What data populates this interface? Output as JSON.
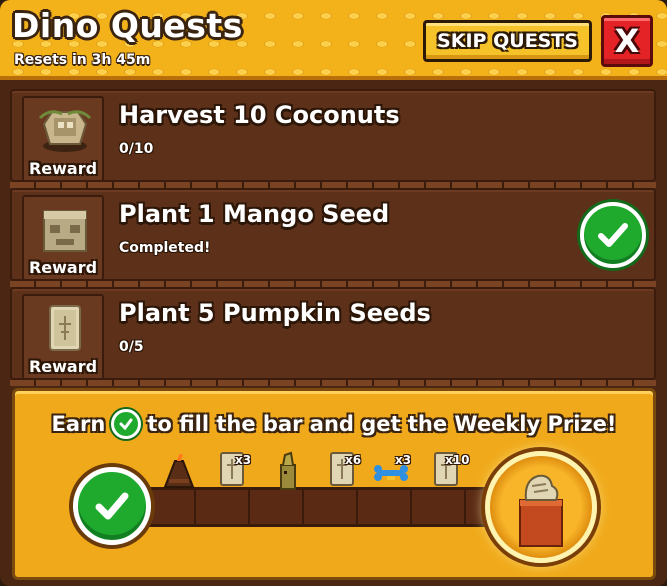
{
  "header": {
    "title": "Dino Quests",
    "resets_text": "Resets in 3h 45m",
    "skip_label": "SKIP QUESTS",
    "close_label": "X"
  },
  "quests": [
    {
      "title": "Harvest 10 Coconuts",
      "progress": "0/10",
      "reward_label": "Reward",
      "reward_icon": "coconut-icon",
      "completed": false
    },
    {
      "title": "Plant 1 Mango Seed",
      "progress": "Completed!",
      "reward_label": "Reward",
      "reward_icon": "stone-block-icon",
      "completed": true
    },
    {
      "title": "Plant 5 Pumpkin Seeds",
      "progress": "0/5",
      "reward_label": "Reward",
      "reward_icon": "stone-tablet-icon",
      "completed": false
    }
  ],
  "weekly": {
    "earn_before": "Earn",
    "earn_after": "to fill the bar and get the Weekly Prize!",
    "progress_fraction": 0.0,
    "milestones": [
      {
        "icon": "volcano-icon",
        "multiplier": ""
      },
      {
        "icon": "stone-tablet-icon",
        "multiplier": "x3"
      },
      {
        "icon": "dino-totem-icon",
        "multiplier": ""
      },
      {
        "icon": "stone-tablet-icon",
        "multiplier": "x6"
      },
      {
        "icon": "blue-bone-icon",
        "multiplier": "x3"
      },
      {
        "icon": "stone-tablet-icon",
        "multiplier": "x10"
      }
    ],
    "prize_icon": "fossil-crate-icon"
  },
  "colors": {
    "header_gold": "#f3b21a",
    "panel_brown": "#4a2613",
    "check_green": "#1faa2e",
    "close_red": "#e42326"
  }
}
